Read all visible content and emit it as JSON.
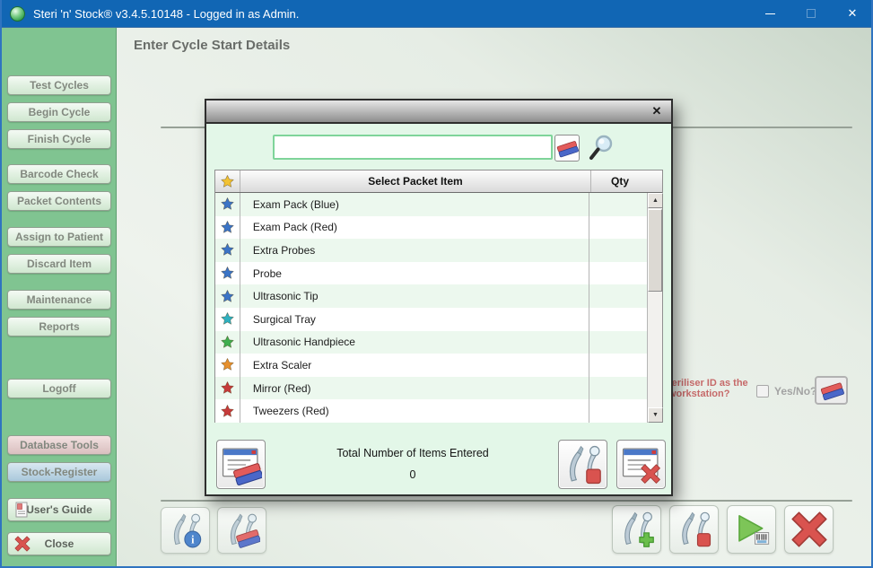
{
  "window": {
    "title": "Steri 'n' Stock® v3.4.5.10148 - Logged in as Admin.",
    "controls": {
      "close_glyph": "✕"
    }
  },
  "sidebar": {
    "buttons": [
      {
        "label": "Test Cycles"
      },
      {
        "label": "Begin Cycle"
      },
      {
        "label": "Finish Cycle"
      },
      {
        "label": "Barcode Check"
      },
      {
        "label": "Packet Contents"
      },
      {
        "label": "Assign to Patient"
      },
      {
        "label": "Discard Item"
      },
      {
        "label": "Maintenance"
      },
      {
        "label": "Reports"
      },
      {
        "label": "Logoff"
      },
      {
        "label": "Database Tools"
      },
      {
        "label": "Stock-Register"
      },
      {
        "label": "User's Guide"
      },
      {
        "label": "Close"
      }
    ]
  },
  "main": {
    "heading": "Enter Cycle Start Details",
    "prompt": {
      "line1": "teriliser ID as the",
      "line2": "workstation?",
      "checkbox_label": "Yes/No?"
    }
  },
  "dialog": {
    "close_glyph": "✕",
    "search": {
      "value": ""
    },
    "table": {
      "header": {
        "item": "Select Packet Item",
        "qty": "Qty"
      },
      "scroll": {
        "up": "▲",
        "down": "▼"
      },
      "header_star_color": "#f2c233",
      "items": [
        {
          "label": "Exam Pack (Blue)",
          "star": "#3b74c6"
        },
        {
          "label": "Exam Pack (Red)",
          "star": "#3b74c6"
        },
        {
          "label": "Extra Probes",
          "star": "#3b74c6"
        },
        {
          "label": "Probe",
          "star": "#3b74c6"
        },
        {
          "label": "Ultrasonic Tip",
          "star": "#3b74c6"
        },
        {
          "label": "Surgical Tray",
          "star": "#2fb0c0"
        },
        {
          "label": "Ultrasonic Handpiece",
          "star": "#3fae4f"
        },
        {
          "label": "Extra Scaler",
          "star": "#e6902e"
        },
        {
          "label": "Mirror (Red)",
          "star": "#c63b3b"
        },
        {
          "label": "Tweezers (Red)",
          "star": "#c63b3b"
        }
      ]
    },
    "footer": {
      "total_label": "Total Number of Items Entered",
      "total_value": "0"
    }
  },
  "colors": {
    "titlebar": "#1166b4",
    "sidebar": "#80c491",
    "modal_body": "#e3f7e8",
    "row_stripe": "#ecf8ee",
    "prompt_red": "#c66a6a"
  }
}
